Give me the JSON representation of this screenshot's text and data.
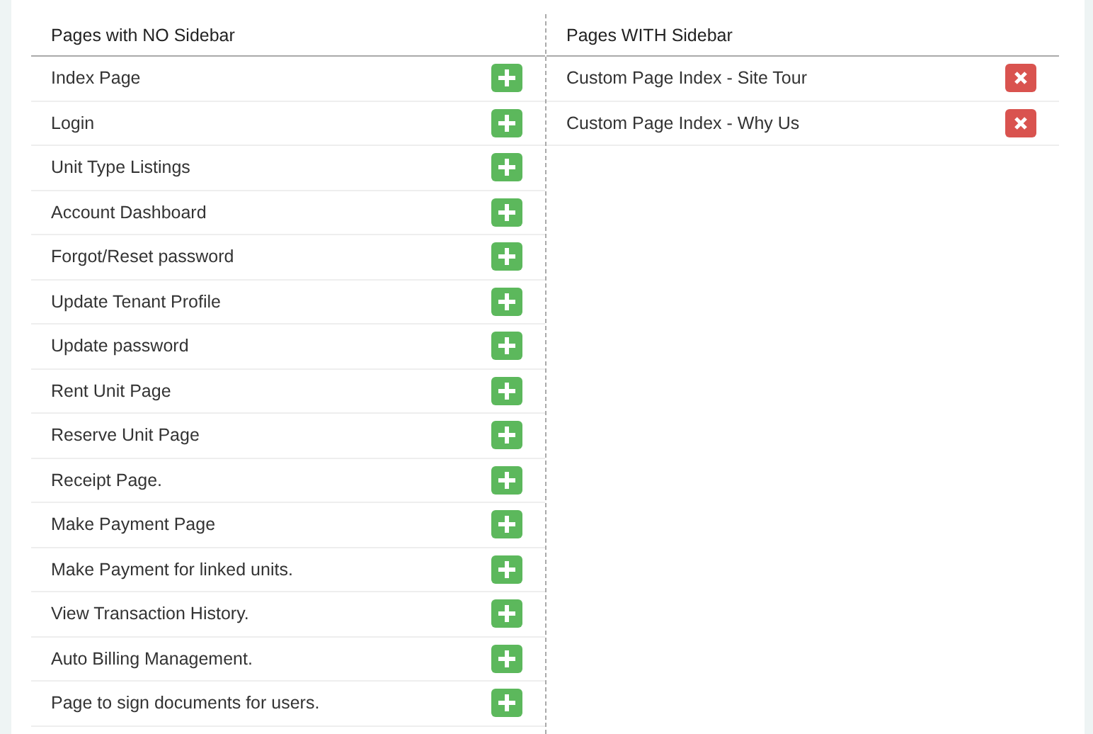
{
  "columns": [
    {
      "heading": "Pages with NO Sidebar",
      "rows": [
        {
          "label": "Index Page",
          "kind": "add"
        },
        {
          "label": "Login",
          "kind": "add"
        },
        {
          "label": "Unit Type Listings",
          "kind": "add"
        },
        {
          "label": "Account Dashboard",
          "kind": "add"
        },
        {
          "label": "Forgot/Reset password",
          "kind": "add"
        },
        {
          "label": "Update Tenant Profile",
          "kind": "add"
        },
        {
          "label": "Update password",
          "kind": "add"
        },
        {
          "label": "Rent Unit Page",
          "kind": "add"
        },
        {
          "label": "Reserve Unit Page",
          "kind": "add"
        },
        {
          "label": "Receipt Page.",
          "kind": "add"
        },
        {
          "label": "Make Payment Page",
          "kind": "add"
        },
        {
          "label": "Make Payment for linked units.",
          "kind": "add"
        },
        {
          "label": "View Transaction History.",
          "kind": "add"
        },
        {
          "label": "Auto Billing Management.",
          "kind": "add"
        },
        {
          "label": "Page to sign documents for users.",
          "kind": "add"
        }
      ]
    },
    {
      "heading": "Pages WITH Sidebar",
      "rows": [
        {
          "label": "Custom Page Index - Site Tour",
          "kind": "remove"
        },
        {
          "label": "Custom Page Index - Why Us",
          "kind": "remove"
        }
      ]
    }
  ]
}
